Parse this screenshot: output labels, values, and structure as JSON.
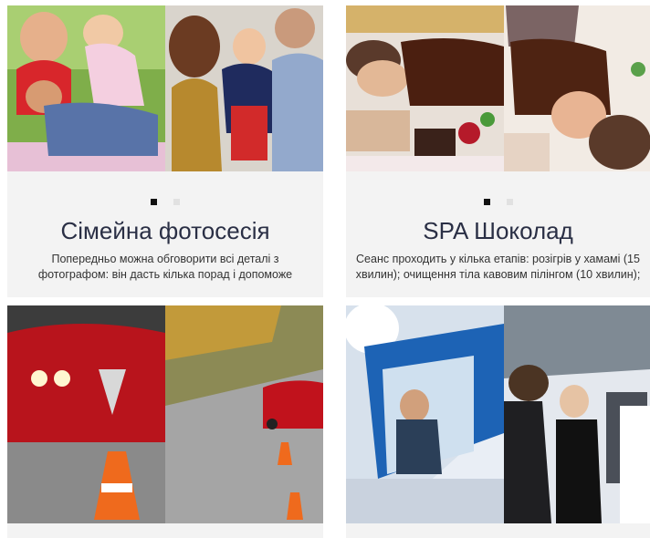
{
  "cards": [
    {
      "title": "Сімейна фотосесія",
      "desc_line1": "Попередньо можна обговорити всі деталі з",
      "desc_line2": "фотографом: він дасть кілька порад і допоможе"
    },
    {
      "title": "SPA Шоколад",
      "desc_line1": "Сеанс проходить у кілька етапів: розігрів у хамамі (15",
      "desc_line2": "хвилин); очищення тіла кавовим пілінгом (10 хвилин);"
    }
  ],
  "colors": {
    "card_bg": "#f3f3f3",
    "title": "#2a2f45",
    "dot_active": "#111111",
    "dot_inactive": "#e1e1e1"
  }
}
